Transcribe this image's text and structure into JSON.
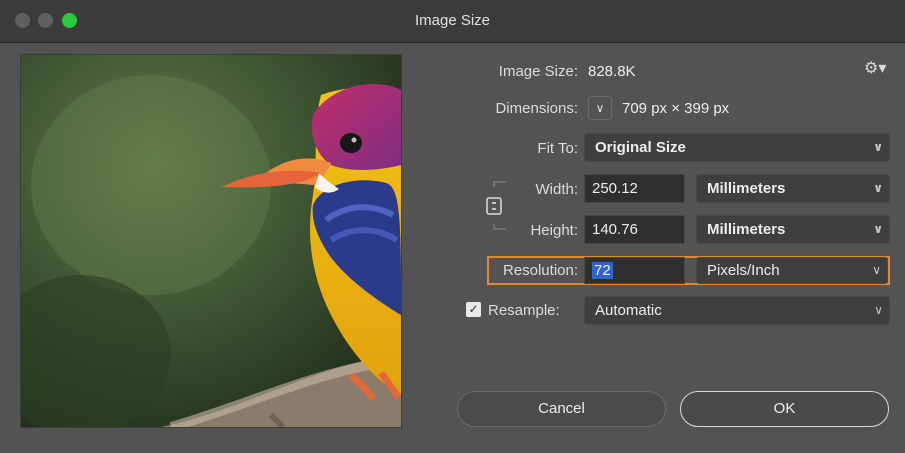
{
  "window": {
    "title": "Image Size"
  },
  "image_size": {
    "label": "Image Size:",
    "value": "828.8K"
  },
  "dimensions": {
    "label": "Dimensions:",
    "value": "709 px  ×  399 px"
  },
  "fit_to": {
    "label": "Fit To:",
    "value": "Original Size"
  },
  "width": {
    "label": "Width:",
    "value": "250.12",
    "unit": "Millimeters"
  },
  "height": {
    "label": "Height:",
    "value": "140.76",
    "unit": "Millimeters"
  },
  "resolution": {
    "label": "Resolution:",
    "value": "72",
    "unit": "Pixels/Inch"
  },
  "resample": {
    "label": "Resample:",
    "value": "Automatic",
    "checked": true
  },
  "buttons": {
    "cancel": "Cancel",
    "ok": "OK"
  },
  "colors": {
    "highlight": "#e08a2c",
    "selection": "#2f65c9",
    "window_bg": "#535353"
  },
  "icons": {
    "gear": "gear-icon",
    "chevron": "chevron-down-icon",
    "link": "link-icon",
    "checkbox": "checkmark-icon"
  }
}
